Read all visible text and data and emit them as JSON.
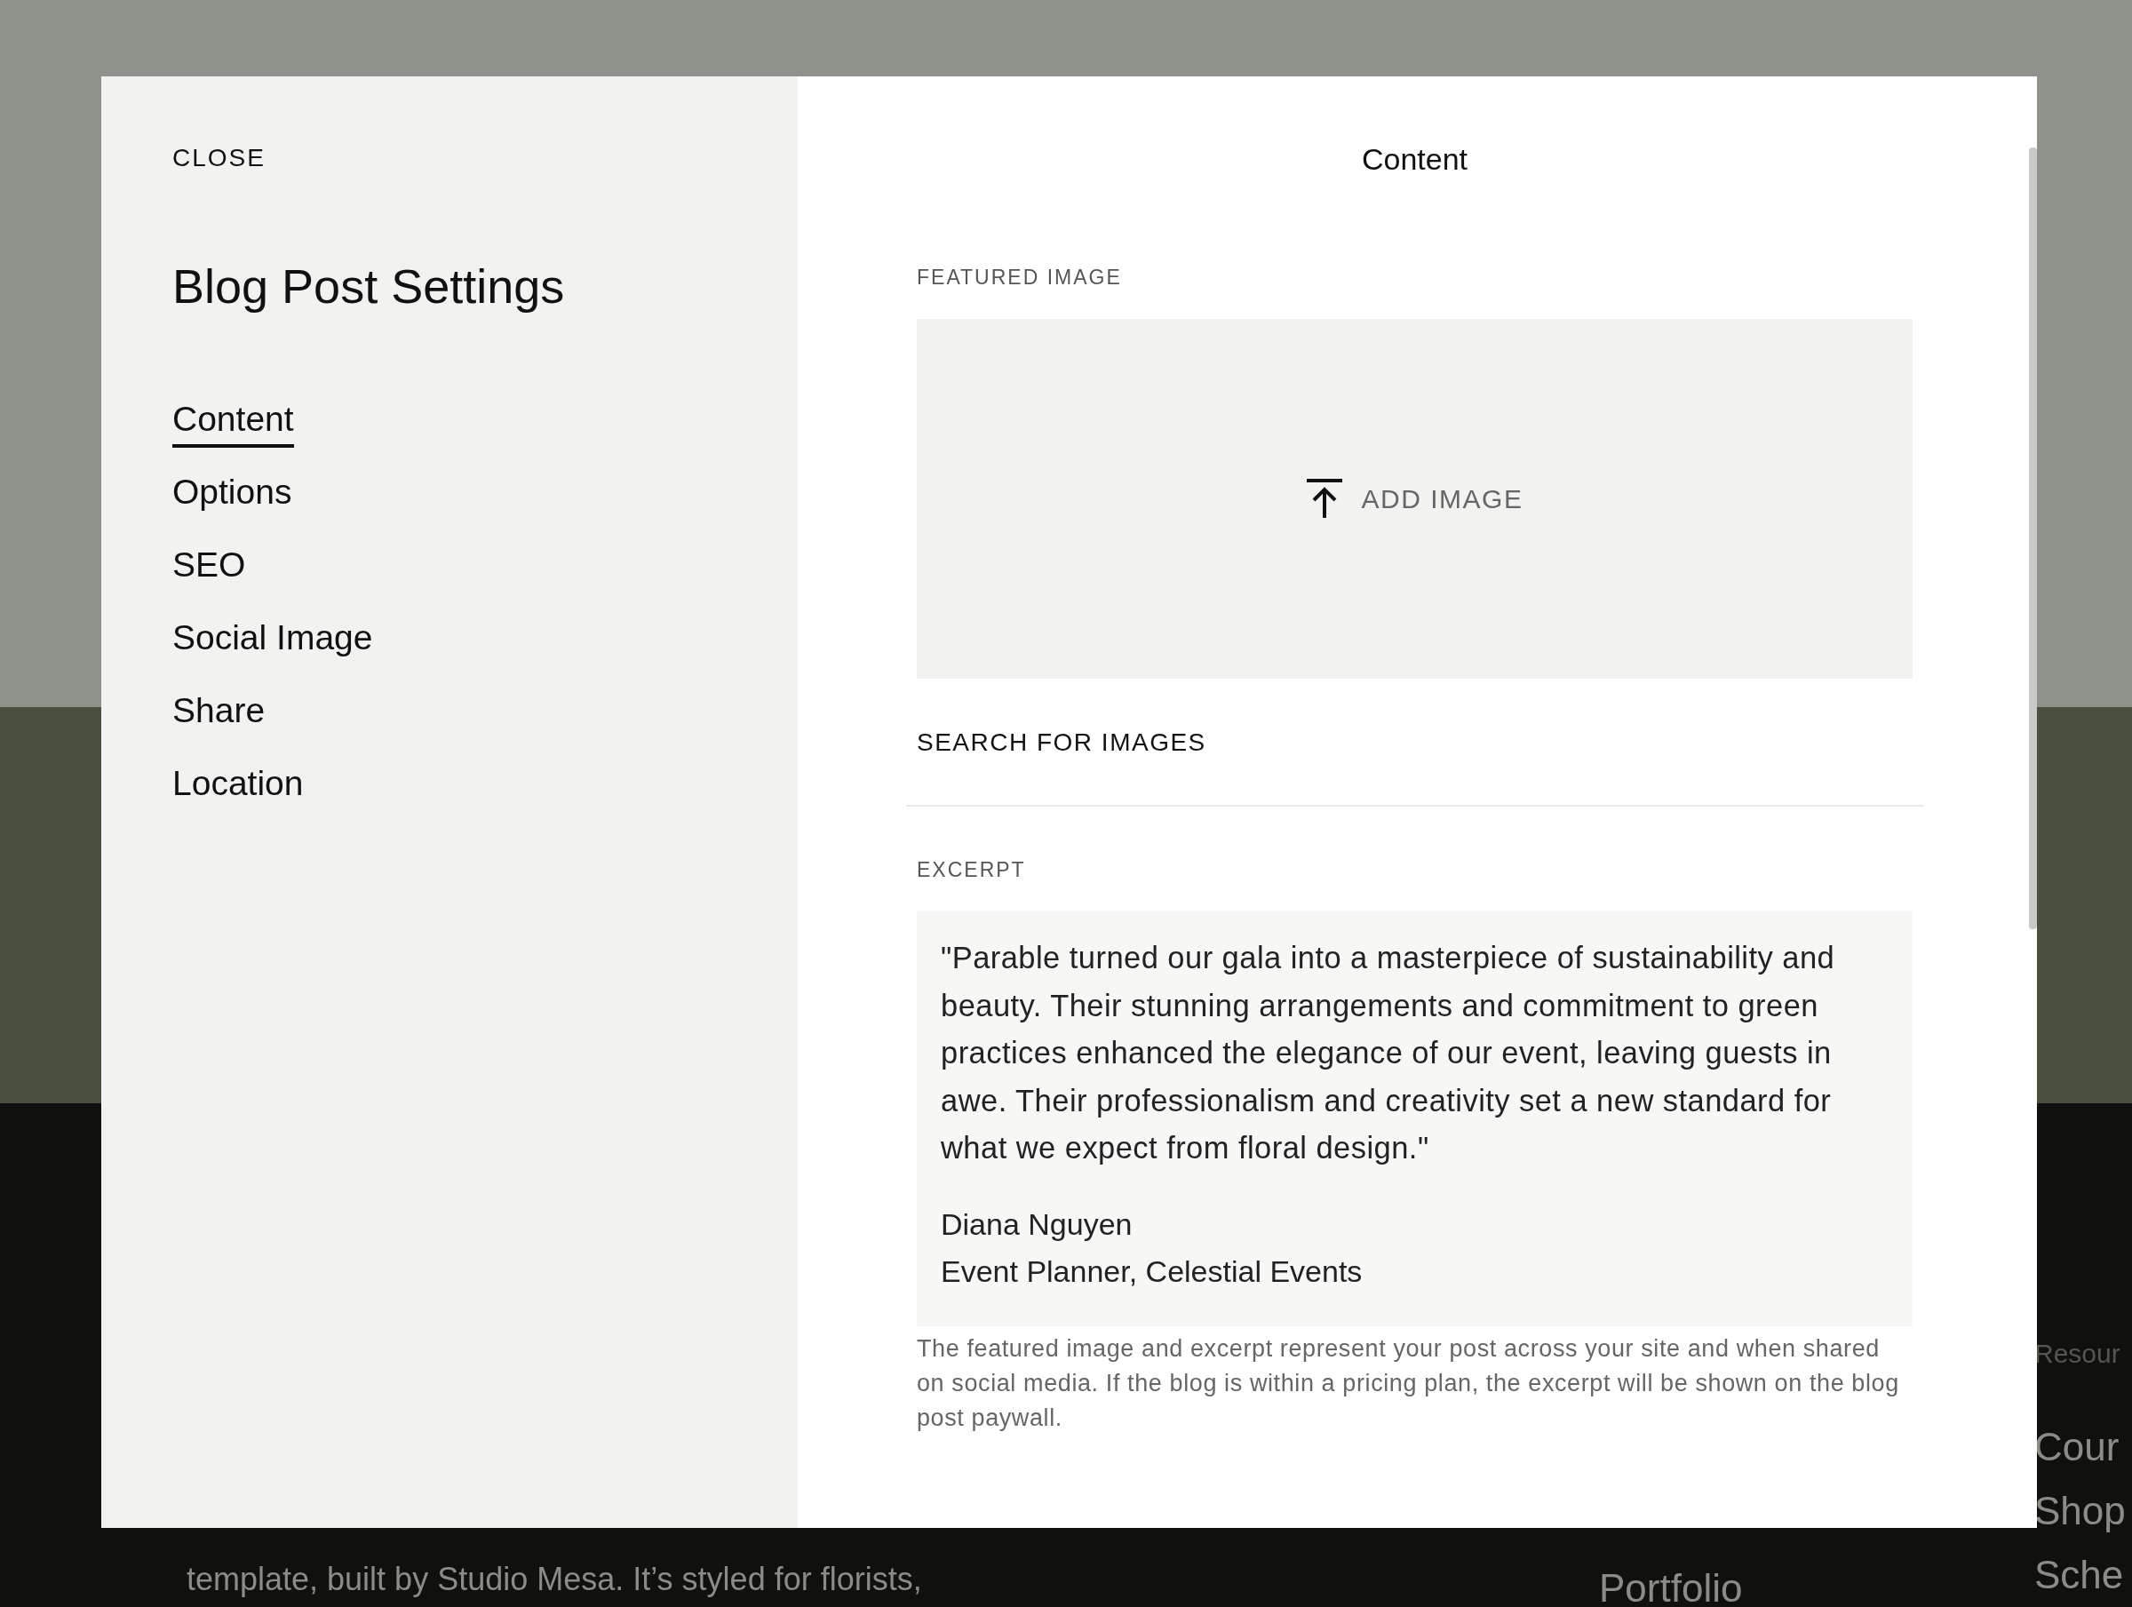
{
  "background_page": {
    "about_lines": [
      "template, built by Studio Mesa. It’s styled for florists,"
    ],
    "nav_links": [
      "Portfolio"
    ],
    "resources": {
      "heading": "Resour",
      "links": [
        "Cour",
        "Shop",
        "Sche"
      ]
    }
  },
  "dialog": {
    "close": "CLOSE",
    "title": "Blog Post Settings",
    "nav": [
      {
        "label": "Content",
        "selected": true
      },
      {
        "label": "Options",
        "selected": false
      },
      {
        "label": "SEO",
        "selected": false
      },
      {
        "label": "Social Image",
        "selected": false
      },
      {
        "label": "Share",
        "selected": false
      },
      {
        "label": "Location",
        "selected": false
      }
    ],
    "panel_title": "Content",
    "featured_image": {
      "label": "FEATURED IMAGE",
      "button": "ADD IMAGE"
    },
    "search_link": "SEARCH FOR IMAGES",
    "excerpt": {
      "label": "EXCERPT",
      "quote": "\"Parable turned our gala into a masterpiece of sustainability and beauty. Their stunning arrangements and commitment to green practices enhanced the elegance of our event, leaving guests in awe. Their professionalism and creativity set a new standard for what we expect from floral design.\"",
      "attribution": [
        "Diana Nguyen",
        "Event Planner, Celestial Events"
      ],
      "help": "The featured image and excerpt represent your post across your site and when shared on social media. If the blog is within a pricing plan, the excerpt will be shown on the blog post paywall."
    }
  }
}
